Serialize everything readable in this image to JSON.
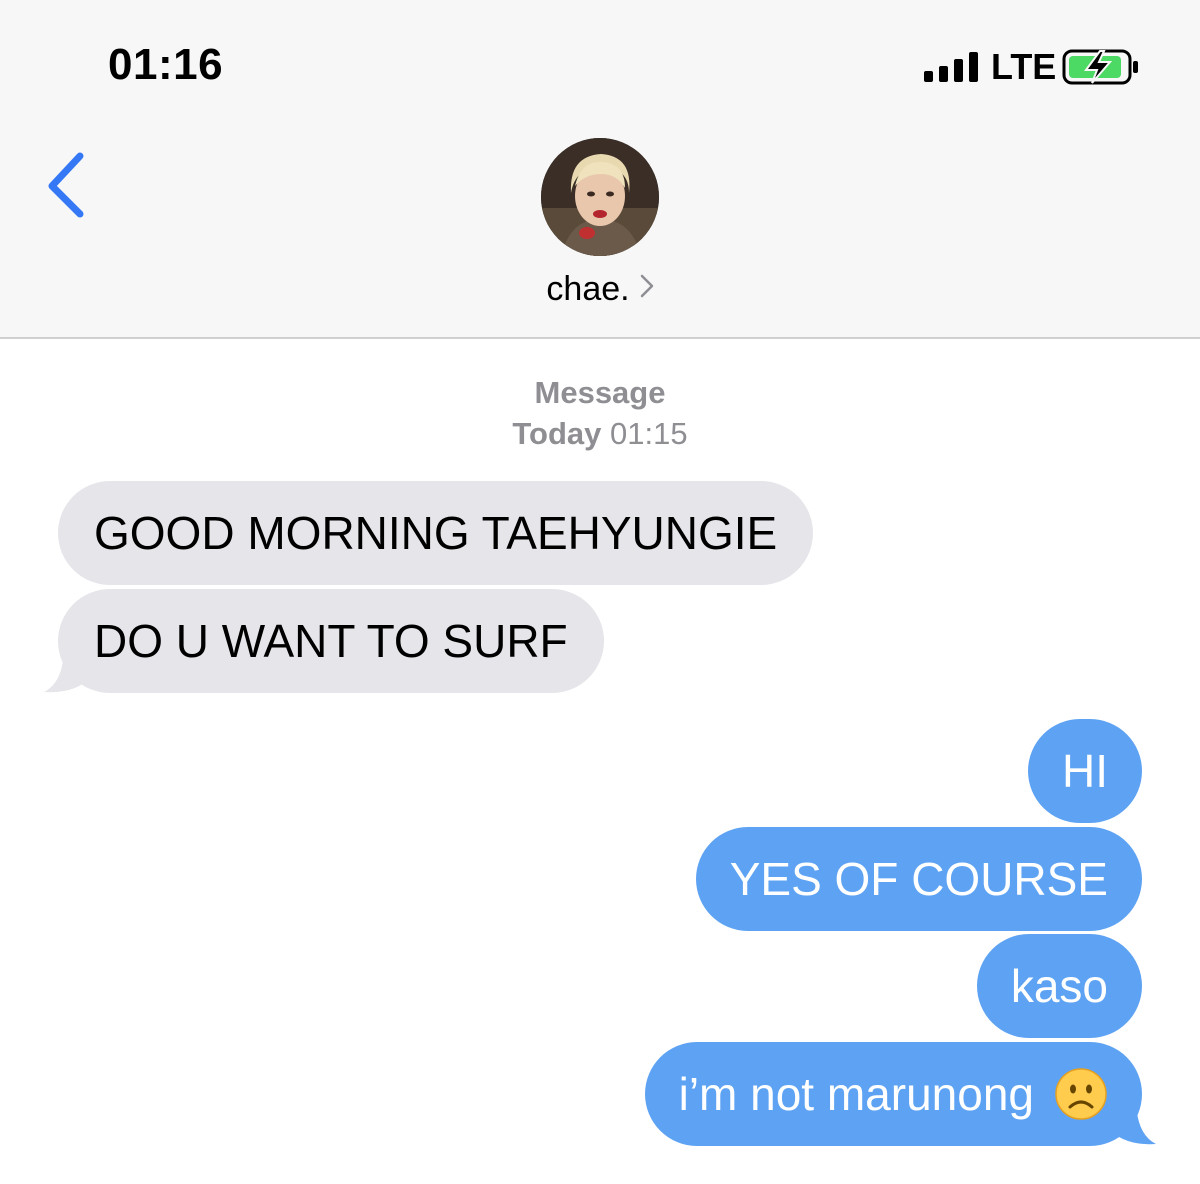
{
  "status_bar": {
    "time": "01:16",
    "network": "LTE",
    "battery_state": "charging",
    "battery_color": "#4cd964"
  },
  "nav": {
    "back_icon": "chevron-left-icon",
    "contact_name": "chae.",
    "contact_chevron": "›"
  },
  "thread": {
    "service": "Message",
    "day": "Today",
    "time": "01:15"
  },
  "messages": [
    {
      "from": "contact",
      "text": "GOOD MORNING TAEHYUNGIE"
    },
    {
      "from": "contact",
      "text": "DO U WANT TO SURF"
    },
    {
      "from": "me",
      "text": "HI"
    },
    {
      "from": "me",
      "text": "YES OF COURSE"
    },
    {
      "from": "me",
      "text": "kaso"
    },
    {
      "from": "me",
      "text": "i’m not marunong",
      "emoji": "frowning-face-icon"
    }
  ],
  "colors": {
    "accent": "#3478f6",
    "sent_bubble": "#5ea3f3",
    "received_bubble": "#e5e5ea",
    "header_bg": "#f7f7f7",
    "meta_text": "#8e8e93"
  }
}
